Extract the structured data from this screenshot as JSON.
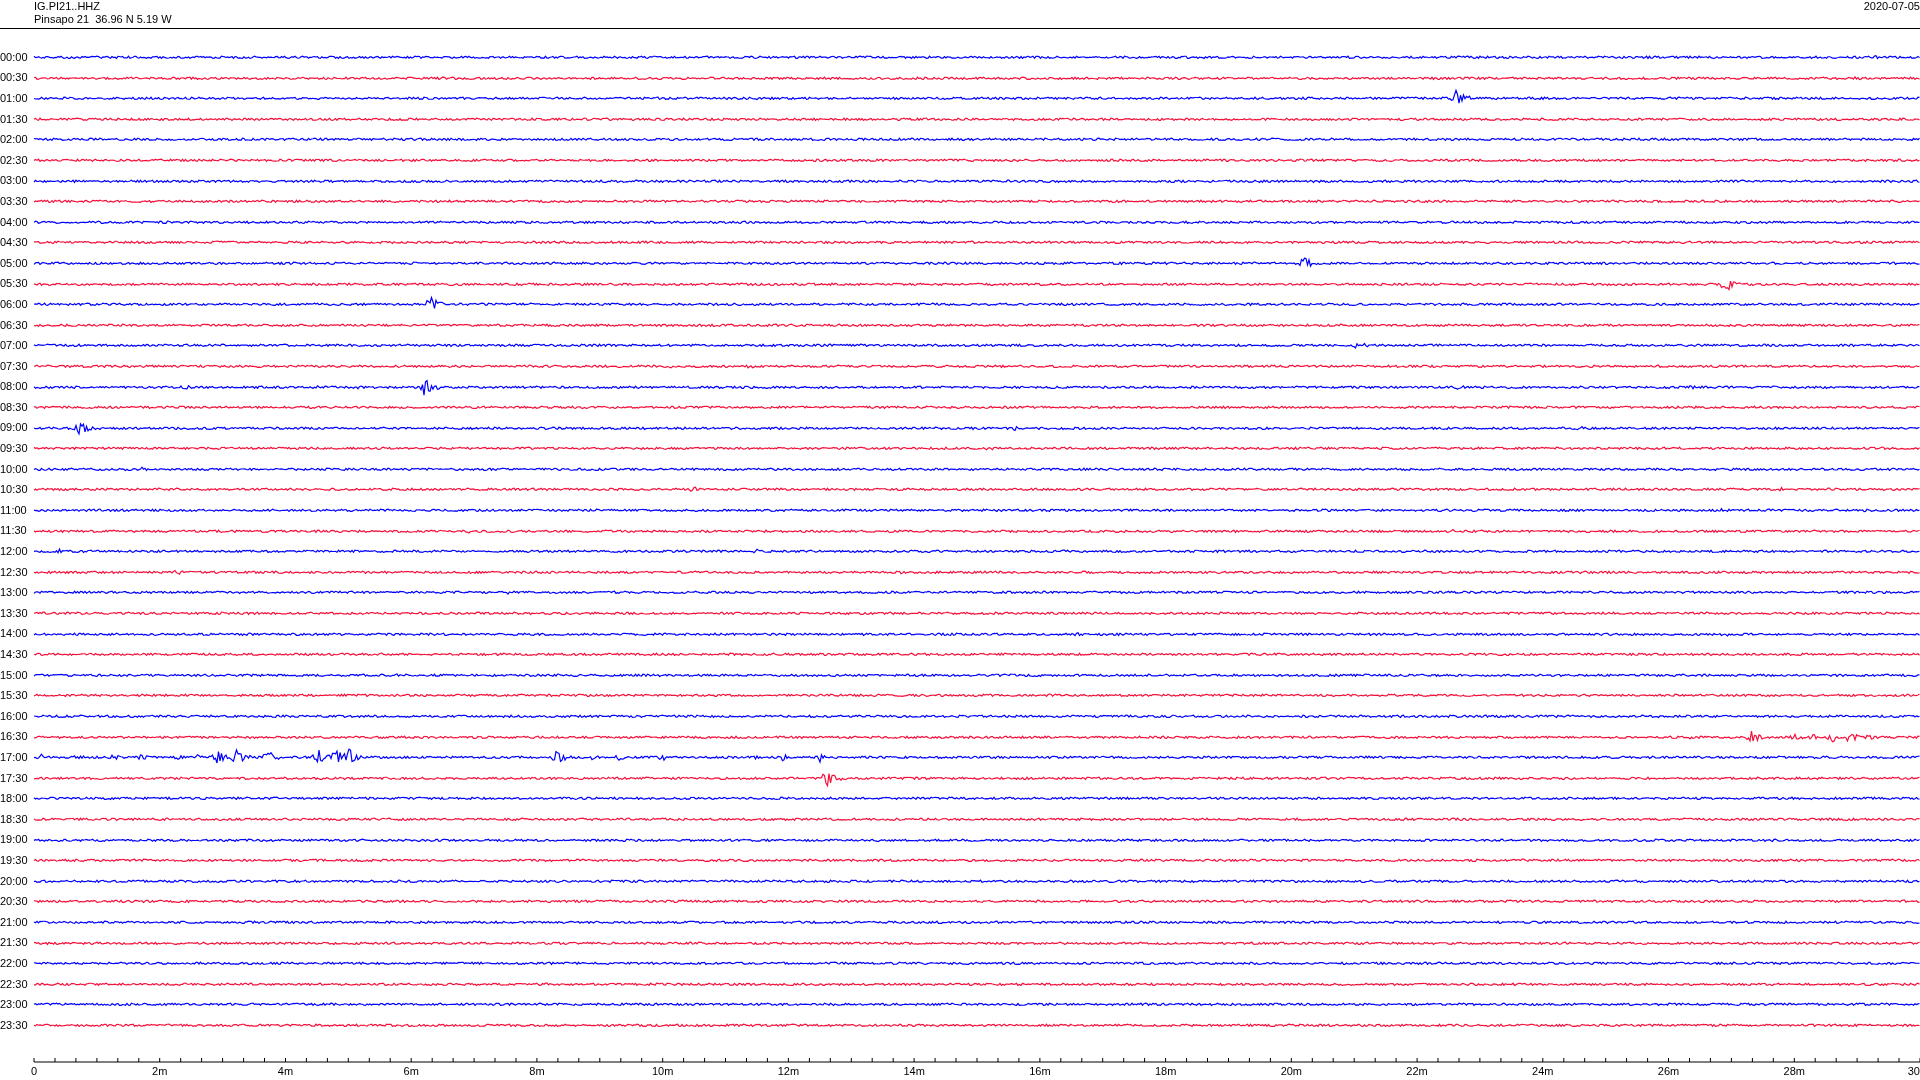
{
  "header": {
    "station_code": "IG.PI21..HHZ",
    "station_location": "Pinsapo 21  36.96 N 5.19 W",
    "date": "2020-07-05"
  },
  "rows": [
    {
      "time": "00:00",
      "color": "#0000ff"
    },
    {
      "time": "00:30",
      "color": "#f5103c"
    },
    {
      "time": "01:00",
      "color": "#0000ff"
    },
    {
      "time": "01:30",
      "color": "#f5103c"
    },
    {
      "time": "02:00",
      "color": "#0000ff"
    },
    {
      "time": "02:30",
      "color": "#f5103c"
    },
    {
      "time": "03:00",
      "color": "#0000ff"
    },
    {
      "time": "03:30",
      "color": "#f5103c"
    },
    {
      "time": "04:00",
      "color": "#0000ff"
    },
    {
      "time": "04:30",
      "color": "#f5103c"
    },
    {
      "time": "05:00",
      "color": "#0000ff"
    },
    {
      "time": "05:30",
      "color": "#f5103c"
    },
    {
      "time": "06:00",
      "color": "#0000ff"
    },
    {
      "time": "06:30",
      "color": "#f5103c"
    },
    {
      "time": "07:00",
      "color": "#0000ff"
    },
    {
      "time": "07:30",
      "color": "#f5103c"
    },
    {
      "time": "08:00",
      "color": "#0000ff"
    },
    {
      "time": "08:30",
      "color": "#f5103c"
    },
    {
      "time": "09:00",
      "color": "#0000ff"
    },
    {
      "time": "09:30",
      "color": "#f5103c"
    },
    {
      "time": "10:00",
      "color": "#0000ff"
    },
    {
      "time": "10:30",
      "color": "#f5103c"
    },
    {
      "time": "11:00",
      "color": "#0000ff"
    },
    {
      "time": "11:30",
      "color": "#f5103c"
    },
    {
      "time": "12:00",
      "color": "#0000ff"
    },
    {
      "time": "12:30",
      "color": "#f5103c"
    },
    {
      "time": "13:00",
      "color": "#0000ff"
    },
    {
      "time": "13:30",
      "color": "#f5103c"
    },
    {
      "time": "14:00",
      "color": "#0000ff"
    },
    {
      "time": "14:30",
      "color": "#f5103c"
    },
    {
      "time": "15:00",
      "color": "#0000ff"
    },
    {
      "time": "15:30",
      "color": "#f5103c"
    },
    {
      "time": "16:00",
      "color": "#0000ff"
    },
    {
      "time": "16:30",
      "color": "#f5103c"
    },
    {
      "time": "17:00",
      "color": "#0000ff"
    },
    {
      "time": "17:30",
      "color": "#f5103c"
    },
    {
      "time": "18:00",
      "color": "#0000ff"
    },
    {
      "time": "18:30",
      "color": "#f5103c"
    },
    {
      "time": "19:00",
      "color": "#0000ff"
    },
    {
      "time": "19:30",
      "color": "#f5103c"
    },
    {
      "time": "20:00",
      "color": "#0000ff"
    },
    {
      "time": "20:30",
      "color": "#f5103c"
    },
    {
      "time": "21:00",
      "color": "#0000ff"
    },
    {
      "time": "21:30",
      "color": "#f5103c"
    },
    {
      "time": "22:00",
      "color": "#0000ff"
    },
    {
      "time": "22:30",
      "color": "#f5103c"
    },
    {
      "time": "23:00",
      "color": "#0000ff"
    },
    {
      "time": "23:30",
      "color": "#f5103c"
    }
  ],
  "x_axis": {
    "labels": [
      "0",
      "2m",
      "4m",
      "6m",
      "8m",
      "10m",
      "12m",
      "14m",
      "16m",
      "18m",
      "20m",
      "22m",
      "24m",
      "26m",
      "28m",
      "30"
    ]
  }
}
